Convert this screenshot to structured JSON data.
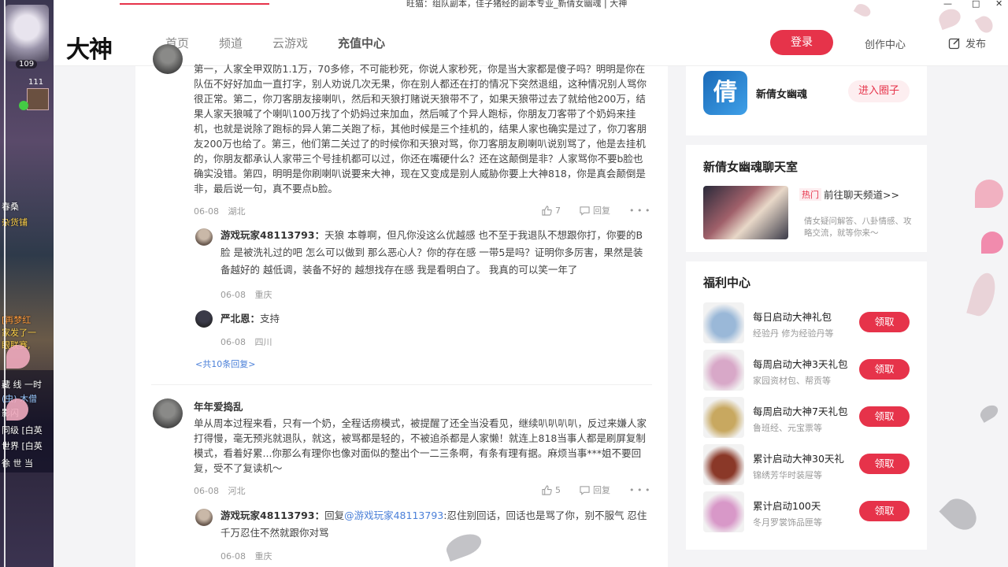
{
  "window": {
    "title": "旺猫：组队副本，佳子猪经的副本专业_新倩女幽魂 | 大神"
  },
  "game_strip": {
    "level_1": "109",
    "level_2": "111",
    "lines": [
      "春桑",
      "杂货铺",
      "[再梦红",
      "家发了一",
      "眼联赛,",
      "藏 线 一时",
      "(虫) 木僧",
      "影闪",
      "同级 [白英",
      "世界 [白英",
      "徐 世 当"
    ]
  },
  "header": {
    "logo": "大神",
    "nav": [
      "首页",
      "频道",
      "云游戏",
      "充值中心"
    ],
    "login": "登录",
    "creator": "创作中心",
    "publish": "发布"
  },
  "main": {
    "comment1": {
      "text": "第一，人家全甲双防1.1万，70多修，不可能秒死，你说人家秒死，你是当大家都是傻子吗？明明是你在队伍不好好加血一直打字，别人劝说几次无果，你在别人都还在打的情况下突然退组，这种情况别人骂你很正常。第二，你刀客朋友接喇叭，然后和天狼打赌说天狼带不了，如果天狼带过去了就给他200万，结果人家天狼喊了个喇叭100万找了个奶妈过来加血，然后喊了个异人跑标，你朋友刀客带了个奶妈来挂机，也就是说除了跑标的异人第二关跑了标，其他时候是三个挂机的，结果人家也确实是过了，你刀客朋友200万也给了。第三，他们第二关过了的时候你和天狼对骂，你刀客朋友刷喇叭说别骂了，他是去挂机的，你朋友都承认人家带三个号挂机都可以过，你还在嘴硬什么？还在这颠倒是非？人家骂你不要b脸也确实没错。第四，明明是你刷喇叭说要来大神，现在又变成是别人威胁你要上大神818，你是真会颠倒是非，最后说一句，真不要点b脸。",
      "date": "06-08",
      "location": "湖北",
      "likes": "7",
      "reply_label": "回复",
      "replies": [
        {
          "name": "游戏玩家48113793：",
          "text": "天狼 本尊啊，但凡你没这么优越感 也不至于我退队不想跟你打，你要的B脸 是被洗礼过的吧 怎么可以做到 那么恶心人？你的存在感 一带5是吗？证明你多厉害，果然是装备越好的 越低调，装备不好的 越想找存在感 我是看明白了。 我真的可以笑一年了",
          "date": "06-08",
          "location": "重庆"
        },
        {
          "name": "严北恩：",
          "text": "支持",
          "date": "06-08",
          "location": "四川"
        }
      ],
      "more": "<共10条回复>"
    },
    "comment2": {
      "author": "年年爱捣乱",
      "text": "单从周本过程来看，只有一个奶，全程话痨模式，被提醒了还全当没看见，继续叭叭叭叭，反过来嫌人家打得慢，毫无预兆就退队，就这，被骂都是轻的，不被追杀都是人家懒！就连上818当事人都是刷屏复制模式，看着好累...你那么有理你也像对面似的整出个一二三条啊，有条有理有据。麻烦当事***姐不要回复，受不了复读机～",
      "date": "06-08",
      "location": "河北",
      "likes": "5",
      "reply_label": "回复",
      "reply": {
        "name": "游戏玩家48113793：",
        "prefix": "回复",
        "mention": "@游戏玩家48113793",
        "text": ":忍住别回话，回话也是骂了你，别不服气 忍住千万忍住不然就跟你对骂",
        "date": "06-08",
        "location": "重庆"
      }
    }
  },
  "sidebar": {
    "circle": {
      "icon_text": "倩",
      "name": "新倩女幽魂",
      "enter": "进入圈子"
    },
    "chat": {
      "title": "新倩女幽魂聊天室",
      "hot": "热门",
      "link": "前往聊天频道>>",
      "desc": "倩女疑问解答、八卦情感、攻略交流，就等你来～"
    },
    "welfare": {
      "title": "福利中心",
      "items": [
        {
          "title": "每日启动大神礼包",
          "sub": "经验丹 修为经验丹等",
          "btn": "领取",
          "color": "#9ab8d8"
        },
        {
          "title": "每周启动大神3天礼包",
          "sub": "家园资材包、帮贡等",
          "btn": "领取",
          "color": "#d8a8c8"
        },
        {
          "title": "每周启动大神7天礼包",
          "sub": "鲁班经、元宝票等",
          "btn": "领取",
          "color": "#c8a860"
        },
        {
          "title": "累计启动大神30天礼",
          "sub": "锦绣芳华时装屉等",
          "btn": "领取",
          "color": "#8a3828"
        },
        {
          "title": "累计启动100天",
          "sub": "冬月罗裳饰品匣等",
          "btn": "领取",
          "color": "#d898c8"
        }
      ]
    }
  }
}
